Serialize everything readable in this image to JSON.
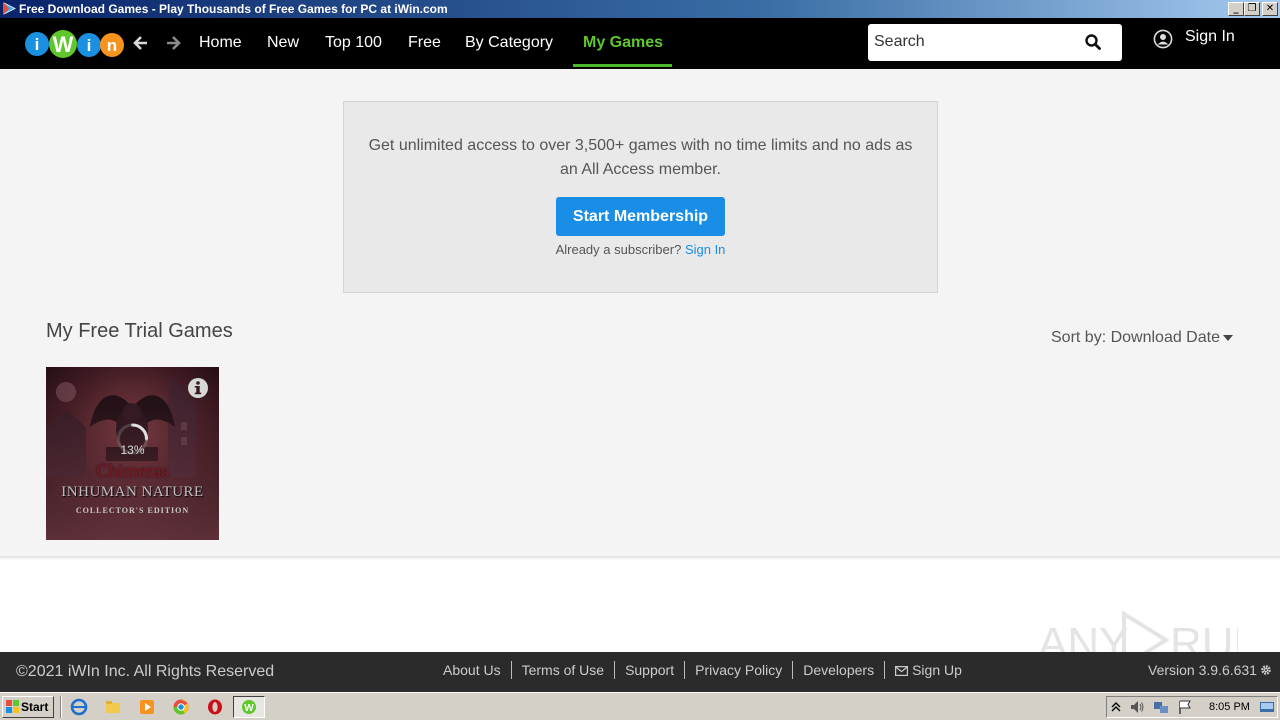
{
  "window": {
    "title": "Free Download Games - Play Thousands of Free Games for PC at iWin.com",
    "controls": [
      "_",
      "❐",
      "✕"
    ]
  },
  "nav": {
    "logo_text": "iWin",
    "back_icon": "arrow-left-icon",
    "forward_icon": "arrow-right-icon",
    "links": [
      "Home",
      "New",
      "Top 100",
      "Free",
      "By Category",
      "My Games"
    ],
    "active": "My Games",
    "search_placeholder": "Search",
    "sign_in": "Sign In"
  },
  "promo": {
    "text": "Get unlimited access to over 3,500+ games with no time limits and no ads as an All Access member.",
    "button": "Start Membership",
    "subscriber_text": "Already a subscriber?",
    "subscriber_link": "Sign In"
  },
  "library": {
    "title": "My Free Trial Games",
    "sort_label": "Sort by: Download Date",
    "games": [
      {
        "title_line1": "Chimeras",
        "title_line2": "INHUMAN NATURE",
        "title_line3": "COLLECTOR'S EDITION",
        "progress_text": "13%",
        "progress": 0.13
      }
    ]
  },
  "footer": {
    "copyright": "©2021 iWIn Inc. All Rights Reserved",
    "links": [
      "About Us",
      "Terms of Use",
      "Support",
      "Privacy Policy",
      "Developers",
      "Sign Up"
    ],
    "version": "Version 3.9.6.631"
  },
  "watermark": "ANY RUN",
  "taskbar": {
    "start": "Start",
    "clock": "8:05 PM"
  },
  "colors": {
    "accent_green": "#5ec72c",
    "button_blue": "#1a8ee6",
    "nav_bg": "#000000",
    "footer_bg": "#2b2b2b"
  }
}
